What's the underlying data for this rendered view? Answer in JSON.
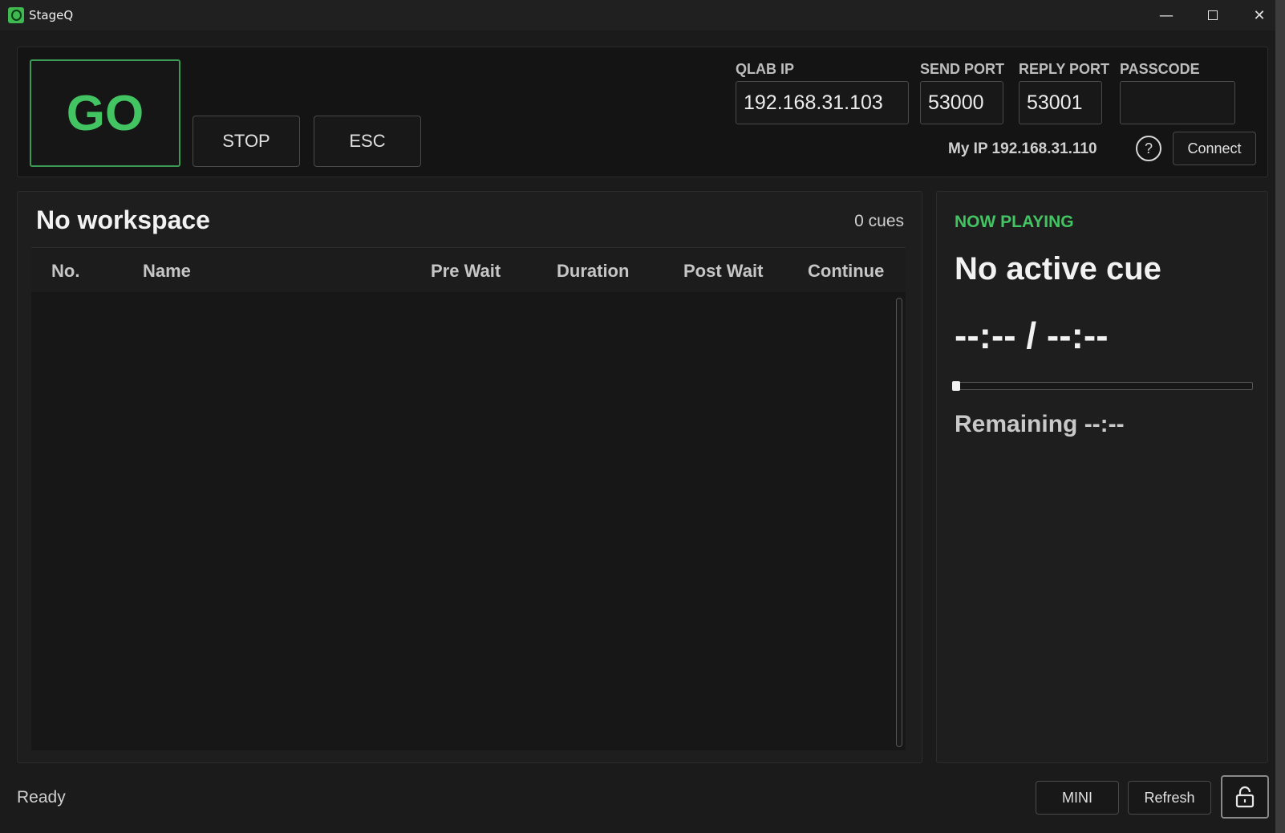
{
  "window": {
    "title": "StageQ",
    "minimize": "—",
    "close": "✕"
  },
  "controls": {
    "go_label": "GO",
    "stop_label": "STOP",
    "esc_label": "ESC"
  },
  "connection": {
    "qlab_ip_label": "QLAB IP",
    "qlab_ip_value": "192.168.31.103",
    "send_port_label": "SEND PORT",
    "send_port_value": "53000",
    "reply_port_label": "REPLY PORT",
    "reply_port_value": "53001",
    "passcode_label": "PASSCODE",
    "passcode_value": "",
    "my_ip": "My IP 192.168.31.110",
    "help_label": "?",
    "connect_label": "Connect"
  },
  "cue_list": {
    "workspace_title": "No workspace",
    "cue_count": "0 cues",
    "columns": [
      "No.",
      "Name",
      "Pre Wait",
      "Duration",
      "Post Wait",
      "Continue"
    ],
    "rows": []
  },
  "now_playing": {
    "label": "NOW PLAYING",
    "cue_name": "No active cue",
    "time": "--:-- / --:--",
    "progress": 0,
    "remaining": "Remaining --:--"
  },
  "status": {
    "text": "Ready"
  },
  "bottom": {
    "mini_label": "MINI",
    "refresh_label": "Refresh"
  },
  "icons": {
    "app": "app-logo-icon",
    "help": "help-icon",
    "lock": "unlock-icon"
  },
  "colors": {
    "accent_green": "#43c463",
    "background": "#1b1b1b",
    "panel": "#1e1e1e"
  }
}
